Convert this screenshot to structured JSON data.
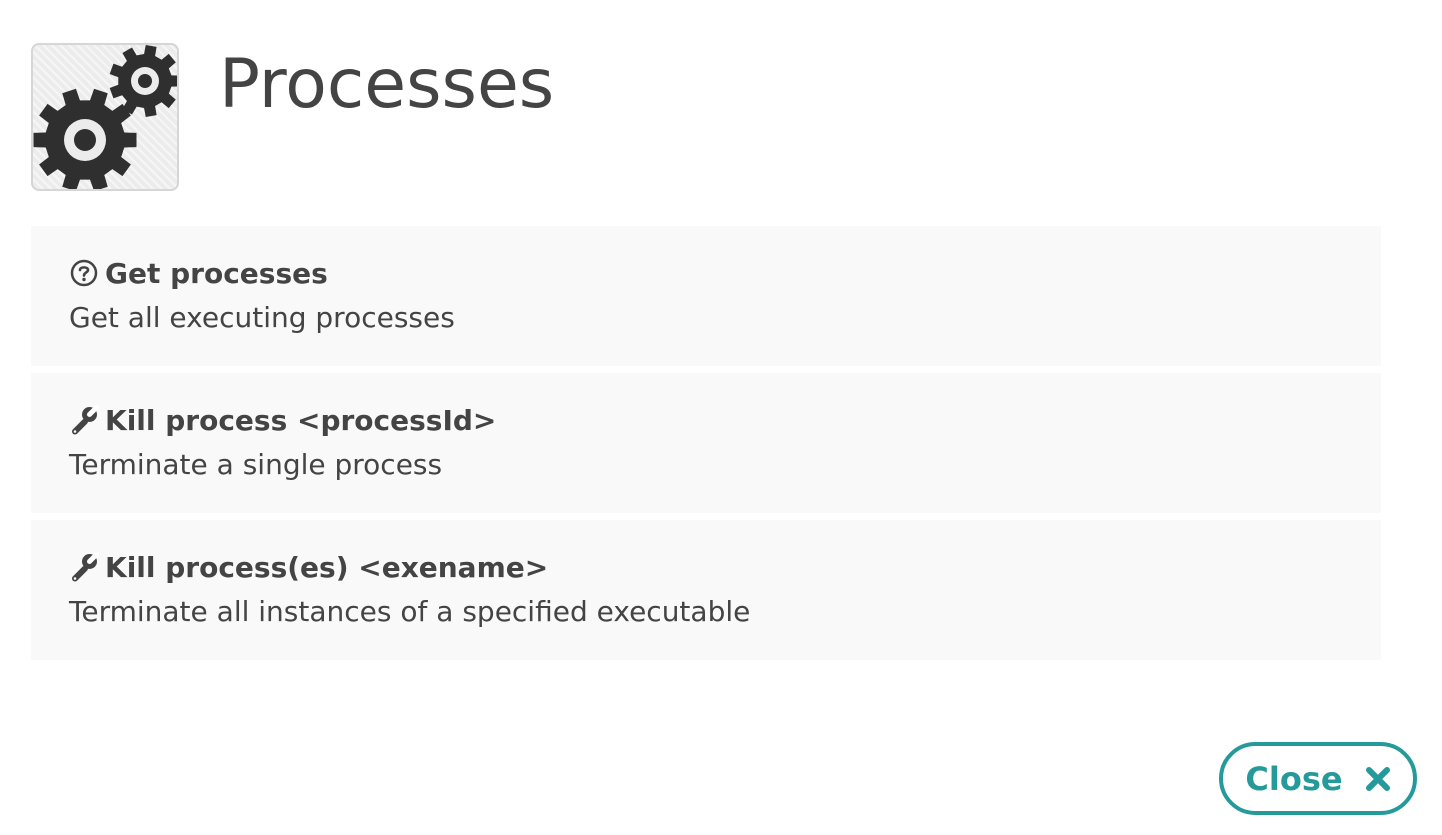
{
  "header": {
    "icon": "gears-icon",
    "title": "Processes"
  },
  "actions": [
    {
      "icon": "question-circle-icon",
      "title": "Get processes",
      "description": "Get all executing processes"
    },
    {
      "icon": "wrench-icon",
      "title": "Kill process <processId>",
      "description": "Terminate a single process"
    },
    {
      "icon": "wrench-icon",
      "title": "Kill process(es) <exename>",
      "description": "Terminate all instances of a specified executable"
    }
  ],
  "footer": {
    "close_label": "Close",
    "close_icon": "close-x-icon"
  },
  "colors": {
    "accent": "#259a9b",
    "text": "#444444",
    "item_background": "#f9f9f9"
  }
}
